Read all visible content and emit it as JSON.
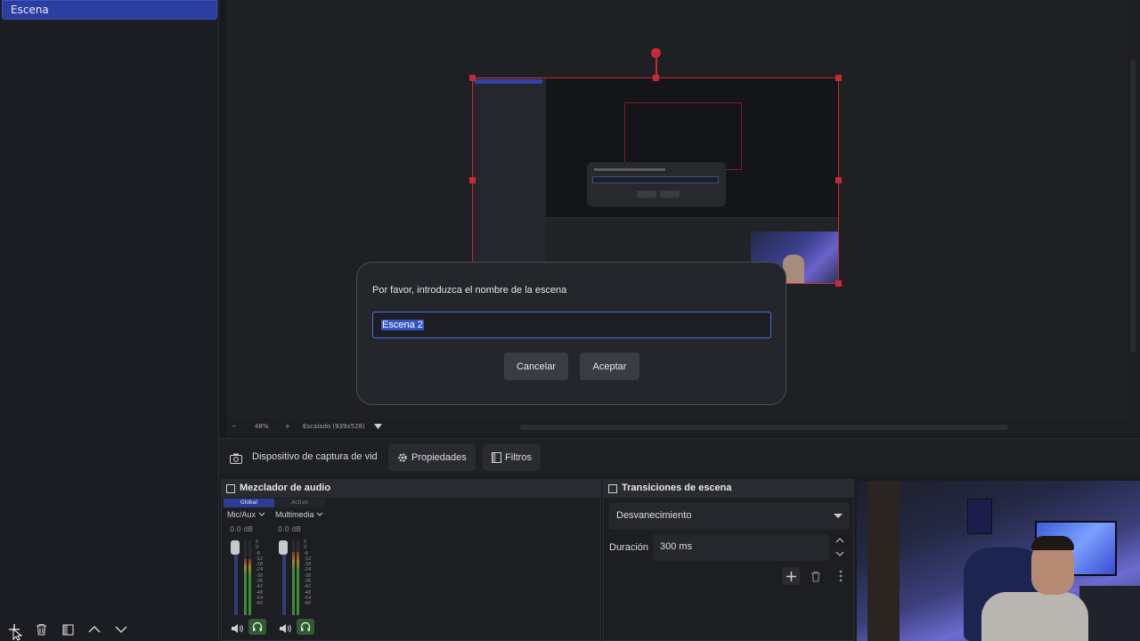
{
  "scenes": {
    "items": [
      {
        "label": "Escena"
      }
    ]
  },
  "preview": {
    "zoom": {
      "minus": "−",
      "level": "48%",
      "plus": "+",
      "scale_mode": "Escalado (939x528)"
    }
  },
  "dialog": {
    "title": "Por favor, introduzca el nombre de la escena",
    "input_value": "Escena 2",
    "cancel_label": "Cancelar",
    "ok_label": "Aceptar"
  },
  "source_bar": {
    "source_name": "Dispositivo de captura de vid",
    "properties_label": "Propiedades",
    "filters_label": "Filtros"
  },
  "mixer": {
    "title": "Mezclador de audio",
    "tabs": [
      "Global",
      "Activo"
    ],
    "channels": [
      {
        "name": "Mic/Aux",
        "db": "0.0 dB",
        "level": 0.75
      },
      {
        "name": "Multimedia",
        "db": "0.0 dB",
        "level": 0.85
      }
    ],
    "scale": [
      "5",
      "0",
      "-6",
      "-12",
      "-18",
      "-24",
      "-30",
      "-36",
      "-42",
      "-48",
      "-54",
      "-60"
    ]
  },
  "transitions": {
    "title": "Transiciones de escena",
    "selected": "Desvanecimiento",
    "duration_label": "Duración",
    "duration_value": "300 ms"
  },
  "colors": {
    "accent": "#3b52c8",
    "selection_red": "#c72a36",
    "panel_bg": "#1d1e22",
    "monitor_green": "#2f5b33"
  },
  "icons": {
    "add": "plus-icon",
    "remove": "trash-icon",
    "filter": "filter-icon",
    "up": "chevron-up-icon",
    "down": "chevron-down-icon",
    "camera": "camera-icon",
    "gear": "gear-icon",
    "volume": "speaker-icon",
    "monitor": "headphones-icon",
    "more": "kebab-icon"
  }
}
